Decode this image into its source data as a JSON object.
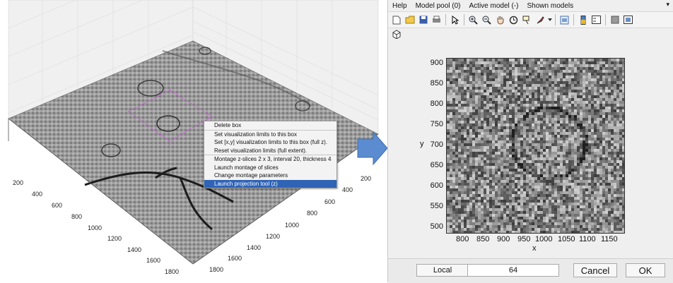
{
  "left_panel": {
    "x_axis_ticks": [
      "200",
      "400",
      "600",
      "800",
      "1000",
      "1200",
      "1400",
      "1600",
      "1800"
    ],
    "y_axis_ticks": [
      "200",
      "400",
      "600",
      "800",
      "1000",
      "1200",
      "1400",
      "1600",
      "1800"
    ],
    "context_menu": {
      "items": [
        "Delete box",
        "Set visualization limits to this box",
        "Set [x,y] visualization limits to this box (full z).",
        "Reset visualization limits (full extent).",
        "Montage z-slices 2 x 3, interval 20, thickness 4",
        "Launch montage of slices",
        "Change montage parameters",
        "Launch projection tool (z)"
      ],
      "selected_item": "Launch projection tool (z)"
    }
  },
  "right_panel": {
    "menu": [
      "Help",
      "Model pool (0)",
      "Active model (-)",
      "Shown models"
    ],
    "menu_minimize": "▾",
    "toolbar_icons": [
      "new-file-icon",
      "open-folder-icon",
      "save-icon",
      "print-icon",
      "pointer-icon",
      "zoom-in-icon",
      "zoom-out-icon",
      "pan-hand-icon",
      "rotate-3d-icon",
      "data-cursor-icon",
      "brush-icon",
      "dropdown-arrow-icon",
      "link-plot-icon",
      "colorbar-icon",
      "legend-icon",
      "hide-plot-tools-icon",
      "show-plot-tools-icon"
    ],
    "toolbar2_icons": [
      "cube-icon"
    ],
    "plot": {
      "y_ticks": [
        "900",
        "850",
        "800",
        "750",
        "700",
        "650",
        "600",
        "550",
        "500"
      ],
      "x_ticks": [
        "800",
        "850",
        "900",
        "950",
        "1000",
        "1050",
        "1100",
        "1150"
      ],
      "xlabel": "x",
      "ylabel": "y"
    },
    "bottom": {
      "local_label": "Local",
      "value": "64",
      "cancel_label": "Cancel",
      "ok_label": "OK"
    }
  },
  "colors": {
    "menu_highlight": "#2f63b5",
    "arrow_fill": "#5b8bd0",
    "box_outline": "#c060d0"
  }
}
